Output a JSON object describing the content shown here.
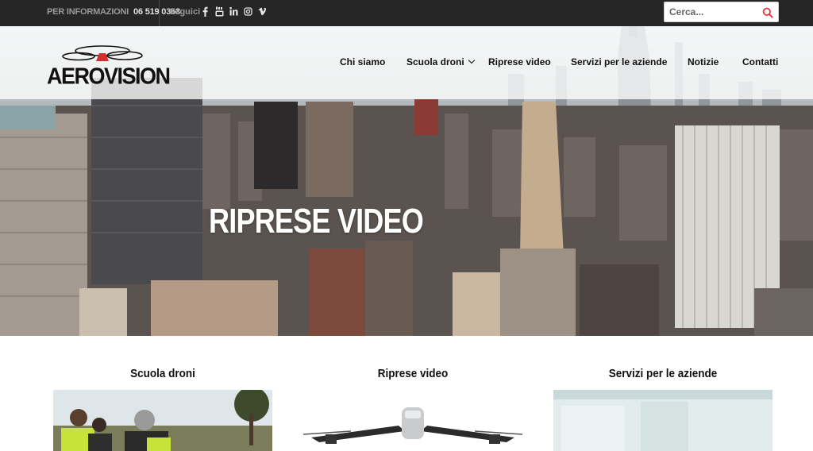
{
  "topbar": {
    "info_label": "PER INFORMAZIONI",
    "phone": "06 519 0363",
    "follow_label": "Seguici",
    "socials": [
      "facebook-icon",
      "youtube-icon",
      "linkedin-icon",
      "instagram-icon",
      "vimeo-icon"
    ],
    "search_placeholder": "Cerca..."
  },
  "brand": {
    "name": "AEROVISION"
  },
  "nav": {
    "items": [
      {
        "label": "Chi siamo"
      },
      {
        "label": "Scuola droni",
        "has_dropdown": true
      },
      {
        "label": "Riprese video"
      },
      {
        "label": "Servizi per le aziende"
      },
      {
        "label": "Notizie"
      },
      {
        "label": "Contatti"
      }
    ]
  },
  "hero": {
    "title": "RIPRESE VIDEO"
  },
  "cards": [
    {
      "title": "Scuola droni"
    },
    {
      "title": "Riprese video"
    },
    {
      "title": "Servizi per le aziende"
    }
  ],
  "colors": {
    "topbar_bg": "#262626",
    "search_icon": "#e53935",
    "text_dark": "#111111"
  }
}
